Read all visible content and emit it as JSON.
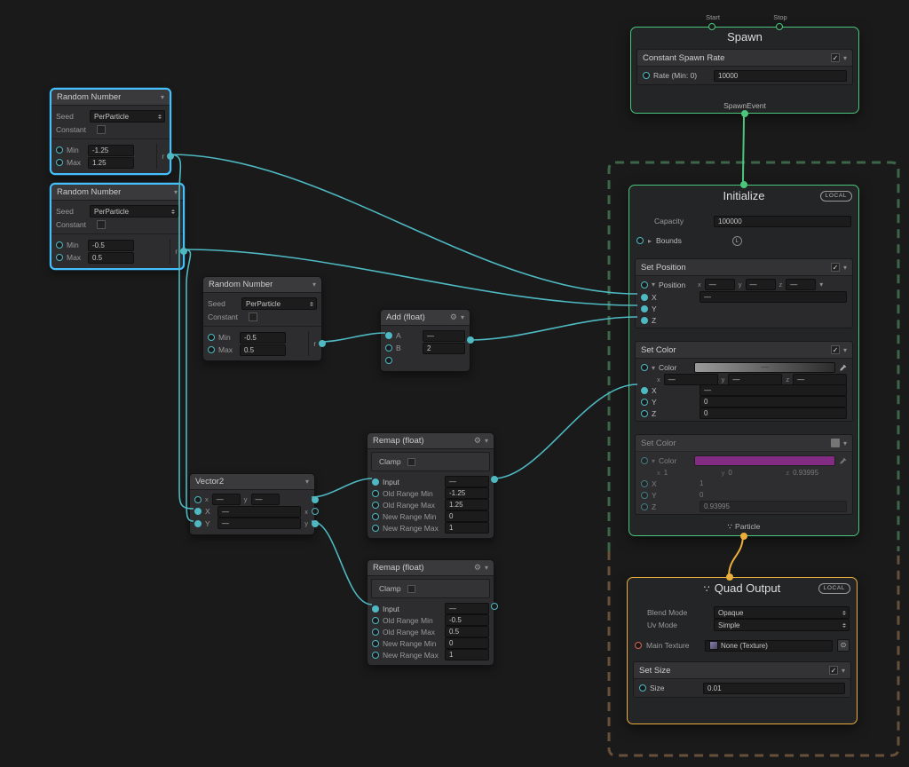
{
  "colors": {
    "selection_blue": "#44C0FF",
    "flow_green": "#4BC77D",
    "link_orange": "#ECAF3E",
    "port_cyan": "#4EB9C2",
    "swatch_magenta": "#C428C4",
    "texture_port_red": "#E0604C",
    "system_border_green": "#3d6549",
    "system_border_orange": "#66503A"
  },
  "icons": {
    "chevron_down": "▾",
    "foldout_closed": "▸",
    "foldout_open": "▾",
    "gear": "⚙",
    "particle": "∵",
    "object_picker": "⊙"
  },
  "spawn": {
    "title": "Spawn",
    "start_label": "Start",
    "stop_label": "Stop",
    "block_title": "Constant Spawn Rate",
    "rate_label": "Rate (Min: 0)",
    "rate_value": "10000",
    "event_label": "SpawnEvent"
  },
  "initialize": {
    "title": "Initialize",
    "badge": "LOCAL",
    "capacity_label": "Capacity",
    "capacity_value": "100000",
    "bounds_label": "Bounds",
    "bounds_badge": "L",
    "set_position": {
      "title": "Set Position",
      "label": "Position",
      "x_label": "x",
      "x_value": "—",
      "y_label": "y",
      "y_value": "—",
      "z_label": "z",
      "z_value": "—",
      "row_x_label": "X",
      "row_x_value": "—",
      "row_y_label": "Y",
      "row_z_label": "Z"
    },
    "set_color_a": {
      "title": "Set Color",
      "label": "Color",
      "swatch_text": "—",
      "x_label": "x",
      "x_value": "—",
      "y_label": "y",
      "y_value": "—",
      "z_label": "z",
      "z_value": "—",
      "row_x_label": "X",
      "row_x_value": "—",
      "row_y_label": "Y",
      "row_y_value": "0",
      "row_z_label": "Z",
      "row_z_value": "0"
    },
    "set_color_b": {
      "title": "Set Color",
      "label": "Color",
      "swatch_color": "#C428C4",
      "x_label": "x",
      "x_value": "1",
      "y_label": "y",
      "y_value": "0",
      "z_label": "z",
      "z_value": "0.93995",
      "row_x_label": "X",
      "row_x_value": "1",
      "row_y_label": "Y",
      "row_y_value": "0",
      "row_z_label": "Z",
      "row_z_value": "0.93995"
    },
    "footer_label": "Particle"
  },
  "quad_output": {
    "title": "Quad Output",
    "badge": "LOCAL",
    "blend_label": "Blend Mode",
    "blend_value": "Opaque",
    "uv_label": "Uv Mode",
    "uv_value": "Simple",
    "texture_label": "Main Texture",
    "texture_value": "None (Texture)",
    "set_size": {
      "title": "Set Size",
      "size_label": "Size",
      "size_value": "0.01"
    }
  },
  "random1": {
    "title": "Random Number",
    "seed_label": "Seed",
    "seed_value": "PerParticle",
    "constant_label": "Constant",
    "min_label": "Min",
    "min_value": "-1.25",
    "max_label": "Max",
    "max_value": "1.25",
    "out_label": "r"
  },
  "random2": {
    "title": "Random Number",
    "seed_label": "Seed",
    "seed_value": "PerParticle",
    "constant_label": "Constant",
    "min_label": "Min",
    "min_value": "-0.5",
    "max_label": "Max",
    "max_value": "0.5",
    "out_label": "r"
  },
  "random3": {
    "title": "Random Number",
    "seed_label": "Seed",
    "seed_value": "PerParticle",
    "constant_label": "Constant",
    "min_label": "Min",
    "min_value": "-0.5",
    "max_label": "Max",
    "max_value": "0.5",
    "out_label": "r"
  },
  "add": {
    "title": "Add (float)",
    "a_label": "A",
    "a_value": "—",
    "b_label": "B",
    "b_value": "2"
  },
  "vector2": {
    "title": "Vector2",
    "x_small_label": "x",
    "x_small_value": "—",
    "y_small_label": "y",
    "y_small_value": "—",
    "row_x_label": "X",
    "row_x_value": "—",
    "row_x_out": "x",
    "row_y_label": "Y",
    "row_y_value": "—",
    "row_y_out": "y"
  },
  "remap1": {
    "title": "Remap (float)",
    "clamp_label": "Clamp",
    "input_label": "Input",
    "input_value": "—",
    "old_min_label": "Old Range Min",
    "old_min_value": "-1.25",
    "old_max_label": "Old Range Max",
    "old_max_value": "1.25",
    "new_min_label": "New Range Min",
    "new_min_value": "0",
    "new_max_label": "New Range Max",
    "new_max_value": "1"
  },
  "remap2": {
    "title": "Remap (float)",
    "clamp_label": "Clamp",
    "input_label": "Input",
    "input_value": "—",
    "old_min_label": "Old Range Min",
    "old_min_value": "-0.5",
    "old_max_label": "Old Range Max",
    "old_max_value": "0.5",
    "new_min_label": "New Range Min",
    "new_min_value": "0",
    "new_max_label": "New Range Max",
    "new_max_value": "1"
  }
}
